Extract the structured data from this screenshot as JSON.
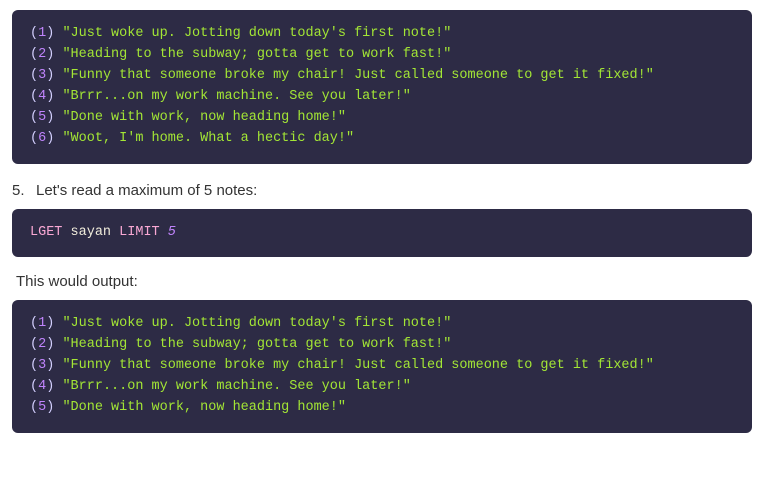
{
  "block1": {
    "lines": [
      {
        "n": "1",
        "text": "\"Just woke up. Jotting down today's first note!\""
      },
      {
        "n": "2",
        "text": "\"Heading to the subway; gotta get to work fast!\""
      },
      {
        "n": "3",
        "text": "\"Funny that someone broke my chair! Just called someone to get it fixed!\""
      },
      {
        "n": "4",
        "text": "\"Brrr...on my work machine. See you later!\""
      },
      {
        "n": "5",
        "text": "\"Done with work, now heading home!\""
      },
      {
        "n": "6",
        "text": "\"Woot, I'm home. What a hectic day!\""
      }
    ]
  },
  "step5_text": "Let's read a maximum of 5 notes:",
  "command": {
    "cmd1": "LGET",
    "ident": "sayan",
    "cmd2": "LIMIT",
    "arg": "5"
  },
  "would_output": "This would output:",
  "block2": {
    "lines": [
      {
        "n": "1",
        "text": "\"Just woke up. Jotting down today's first note!\""
      },
      {
        "n": "2",
        "text": "\"Heading to the subway; gotta get to work fast!\""
      },
      {
        "n": "3",
        "text": "\"Funny that someone broke my chair! Just called someone to get it fixed!\""
      },
      {
        "n": "4",
        "text": "\"Brrr...on my work machine. See you later!\""
      },
      {
        "n": "5",
        "text": "\"Done with work, now heading home!\""
      }
    ]
  }
}
